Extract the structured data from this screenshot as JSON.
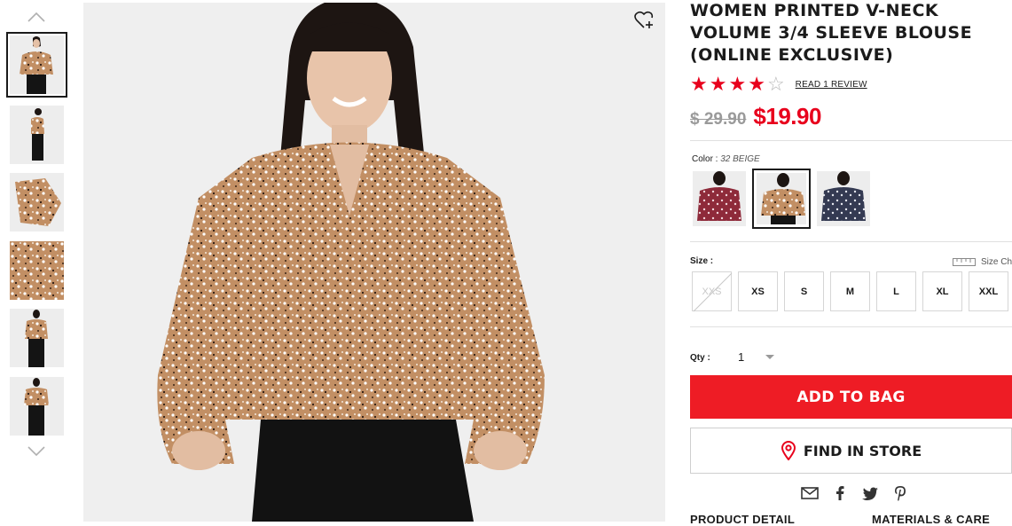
{
  "product": {
    "title": "WOMEN PRINTED V-NECK VOLUME 3/4 SLEEVE BLOUSE (ONLINE EXCLUSIVE)",
    "rating": 4,
    "rating_max": 5,
    "review_link": "READ 1 REVIEW",
    "price_original": "$ 29.90",
    "price_sale": "$19.90"
  },
  "color": {
    "label": "Color :",
    "selected": "32 BEIGE",
    "swatches": [
      "red-print",
      "beige-print",
      "navy-print"
    ]
  },
  "size": {
    "label": "Size :",
    "chart_label": "Size Ch",
    "options": [
      "XXS",
      "XS",
      "S",
      "M",
      "L",
      "XL",
      "XXL"
    ],
    "unavailable": [
      "XXS"
    ]
  },
  "quantity": {
    "label": "Qty :",
    "value": "1"
  },
  "actions": {
    "add_to_bag": "ADD TO BAG",
    "find_in_store": "FIND IN STORE"
  },
  "share_icons": [
    "email-icon",
    "facebook-icon",
    "twitter-icon",
    "pinterest-icon"
  ],
  "tabs": [
    "PRODUCT DETAIL",
    "MATERIALS & CARE"
  ],
  "thumbnails": [
    "front-view",
    "side-view",
    "sleeve-detail",
    "fabric-detail",
    "back-view",
    "front-full-view"
  ],
  "colors": {
    "accent_red": "#e8001c",
    "button_red": "#ee1c25",
    "text": "#1b1b1b",
    "beige": "#c28f64"
  }
}
